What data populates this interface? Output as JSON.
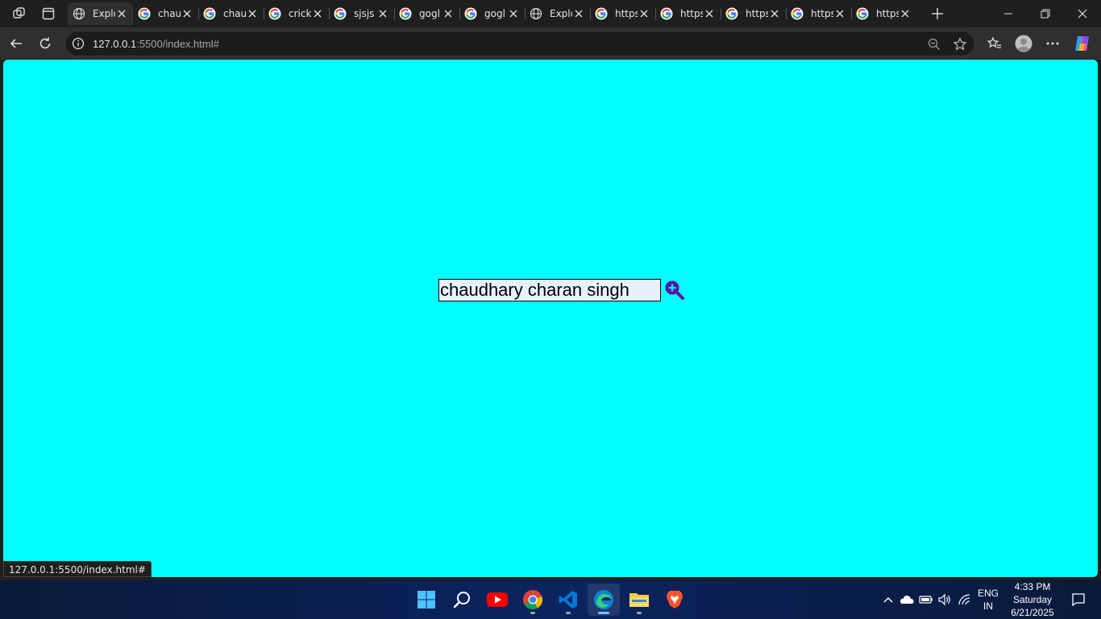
{
  "browser": {
    "tabs": [
      {
        "title": "Explore",
        "icon": "globe-icon",
        "active": true
      },
      {
        "title": "chaudhary",
        "icon": "google-icon"
      },
      {
        "title": "chaudhary",
        "icon": "google-icon"
      },
      {
        "title": "cricket",
        "icon": "google-icon"
      },
      {
        "title": "sjsjs",
        "icon": "google-icon"
      },
      {
        "title": "gogl",
        "icon": "google-icon"
      },
      {
        "title": "gogl",
        "icon": "google-icon"
      },
      {
        "title": "Explore",
        "icon": "globe-icon"
      },
      {
        "title": "https",
        "icon": "google-icon"
      },
      {
        "title": "https",
        "icon": "google-icon"
      },
      {
        "title": "https",
        "icon": "google-icon"
      },
      {
        "title": "https",
        "icon": "google-icon"
      },
      {
        "title": "https",
        "icon": "google-icon"
      }
    ],
    "address": {
      "host": "127.0.0.1",
      "rest": ":5500/index.html#"
    },
    "status_url": "127.0.0.1:5500/index.html#"
  },
  "page": {
    "background": "#00ffff",
    "search": {
      "value": "chaudhary charan singh",
      "button_icon": "search-zoom-in-icon",
      "button_color": "#5b0fa8"
    }
  },
  "taskbar": {
    "apps": [
      "windows-start-icon",
      "search-icon",
      "youtube-icon",
      "chrome-icon",
      "vscode-icon",
      "edge-icon",
      "file-explorer-icon",
      "brave-icon"
    ],
    "language": {
      "line1": "ENG",
      "line2": "IN"
    },
    "clock": {
      "time": "4:33 PM",
      "day": "Saturday",
      "date": "6/21/2025"
    }
  }
}
